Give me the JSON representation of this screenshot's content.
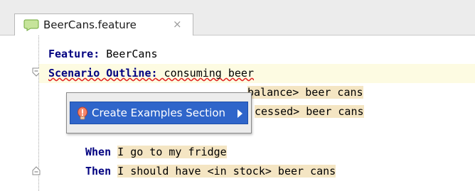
{
  "tab": {
    "title": "BeerCans.feature",
    "close_glyph": "×",
    "icon": "cucumber-feature-icon"
  },
  "editor": {
    "lines": [
      {
        "keyword": "Feature:",
        "text": " BeerCans"
      },
      {
        "keyword": "Scenario Outline:",
        "text": " consuming beer"
      },
      {
        "keyword": "",
        "text": "balance> beer cans"
      },
      {
        "keyword": "",
        "text": "cessed> beer cans"
      },
      {
        "keyword": "When",
        "text": "I go to my fridge"
      },
      {
        "keyword": "Then",
        "text": "I should have <in stock> beer cans"
      }
    ]
  },
  "popup": {
    "item_label": "Create Examples Section",
    "item_icon": "intention-bulb-icon",
    "item_color": "#2f65ca"
  }
}
